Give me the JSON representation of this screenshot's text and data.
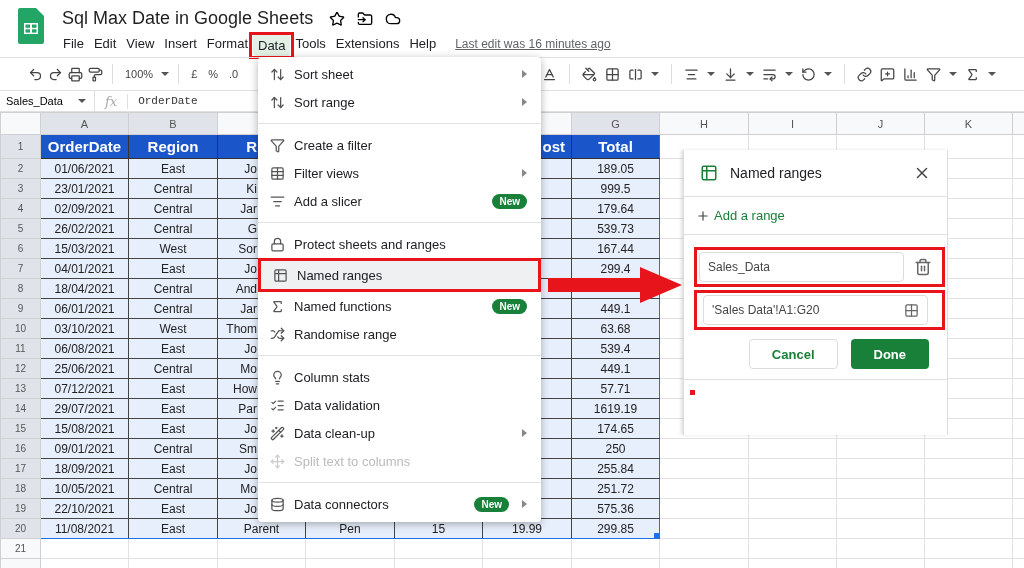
{
  "header": {
    "title": "Sql Max Date in Google Sheets",
    "menus": [
      {
        "label": "File",
        "selected": false,
        "annotated": false
      },
      {
        "label": "Edit",
        "selected": false,
        "annotated": false
      },
      {
        "label": "View",
        "selected": false,
        "annotated": false
      },
      {
        "label": "Insert",
        "selected": false,
        "annotated": false
      },
      {
        "label": "Format",
        "selected": false,
        "annotated": false
      },
      {
        "label": "Data",
        "selected": true,
        "annotated": true
      },
      {
        "label": "Tools",
        "selected": false,
        "annotated": false
      },
      {
        "label": "Extensions",
        "selected": false,
        "annotated": false
      },
      {
        "label": "Help",
        "selected": false,
        "annotated": false
      }
    ],
    "last_edit": "Last edit was 16 minutes ago"
  },
  "toolbar": {
    "zoom": "100%",
    "currency": "£",
    "percent": "%",
    "decimal": ".0"
  },
  "formula_bar": {
    "name_box": "Sales_Data",
    "fx": "fx",
    "value": "OrderDate"
  },
  "sheet": {
    "columns": [
      {
        "label": "A",
        "selected": true
      },
      {
        "label": "B",
        "selected": true
      },
      null,
      null,
      null,
      null,
      {
        "label": "G",
        "selected": true
      },
      {
        "label": "H",
        "selected": false
      },
      {
        "label": "I",
        "selected": false
      },
      {
        "label": "J",
        "selected": false
      },
      {
        "label": "K",
        "selected": false
      }
    ],
    "rows": [
      {
        "number": "1",
        "selected": true,
        "kind": "header",
        "cells": [
          "OrderDate",
          "Region",
          "R",
          null,
          null,
          "ost",
          "Total"
        ]
      },
      {
        "number": "2",
        "selected": true,
        "kind": "data",
        "cells": [
          "01/06/2021",
          "East",
          "Jo",
          null,
          null,
          null,
          "189.05"
        ]
      },
      {
        "number": "3",
        "selected": true,
        "kind": "data",
        "cells": [
          "23/01/2021",
          "Central",
          "Ki",
          null,
          null,
          null,
          "999.5"
        ]
      },
      {
        "number": "4",
        "selected": true,
        "kind": "data",
        "cells": [
          "02/09/2021",
          "Central",
          "Jar",
          null,
          null,
          null,
          "179.64"
        ]
      },
      {
        "number": "5",
        "selected": true,
        "kind": "data",
        "cells": [
          "26/02/2021",
          "Central",
          "G",
          null,
          null,
          null,
          "539.73"
        ]
      },
      {
        "number": "6",
        "selected": true,
        "kind": "data",
        "cells": [
          "15/03/2021",
          "West",
          "Sor",
          null,
          null,
          null,
          "167.44"
        ]
      },
      {
        "number": "7",
        "selected": true,
        "kind": "data",
        "cells": [
          "04/01/2021",
          "East",
          "Jo",
          null,
          null,
          null,
          "299.4"
        ]
      },
      {
        "number": "8",
        "selected": true,
        "kind": "data",
        "cells": [
          "18/04/2021",
          "Central",
          "And",
          null,
          null,
          null,
          null
        ]
      },
      {
        "number": "9",
        "selected": true,
        "kind": "data",
        "cells": [
          "06/01/2021",
          "Central",
          "Jar",
          null,
          null,
          null,
          "449.1"
        ]
      },
      {
        "number": "10",
        "selected": true,
        "kind": "data",
        "cells": [
          "03/10/2021",
          "West",
          "Thom",
          null,
          null,
          null,
          "63.68"
        ]
      },
      {
        "number": "11",
        "selected": true,
        "kind": "data",
        "cells": [
          "06/08/2021",
          "East",
          "Jo",
          null,
          null,
          null,
          "539.4"
        ]
      },
      {
        "number": "12",
        "selected": true,
        "kind": "data",
        "cells": [
          "25/06/2021",
          "Central",
          "Mo",
          null,
          null,
          null,
          "449.1"
        ]
      },
      {
        "number": "13",
        "selected": true,
        "kind": "data",
        "cells": [
          "07/12/2021",
          "East",
          "How",
          null,
          null,
          null,
          "57.71"
        ]
      },
      {
        "number": "14",
        "selected": true,
        "kind": "data",
        "cells": [
          "29/07/2021",
          "East",
          "Par",
          null,
          null,
          null,
          "1619.19"
        ]
      },
      {
        "number": "15",
        "selected": true,
        "kind": "data",
        "cells": [
          "15/08/2021",
          "East",
          "Jo",
          null,
          null,
          null,
          "174.65"
        ]
      },
      {
        "number": "16",
        "selected": true,
        "kind": "data",
        "cells": [
          "09/01/2021",
          "Central",
          "Sm",
          null,
          null,
          null,
          "250"
        ]
      },
      {
        "number": "17",
        "selected": true,
        "kind": "data",
        "cells": [
          "18/09/2021",
          "East",
          "Jo",
          null,
          null,
          null,
          "255.84"
        ]
      },
      {
        "number": "18",
        "selected": true,
        "kind": "data",
        "cells": [
          "10/05/2021",
          "Central",
          "Mo",
          null,
          null,
          null,
          "251.72"
        ]
      },
      {
        "number": "19",
        "selected": true,
        "kind": "data",
        "cells": [
          "22/10/2021",
          "East",
          "Jo",
          null,
          null,
          null,
          "575.36"
        ]
      },
      {
        "number": "20",
        "selected": true,
        "kind": "data",
        "cells": [
          "11/08/2021",
          "East",
          "Parent",
          "Pen",
          "15",
          "19.99",
          "299.85"
        ]
      },
      {
        "number": "21",
        "selected": false,
        "kind": "empty"
      }
    ]
  },
  "data_menu": {
    "items": [
      {
        "kind": "item",
        "label": "Sort sheet",
        "submenu": true,
        "selected": false,
        "annotated": false,
        "disabled": false
      },
      {
        "kind": "item",
        "label": "Sort range",
        "submenu": true,
        "selected": false,
        "annotated": false,
        "disabled": false
      },
      {
        "kind": "divider"
      },
      {
        "kind": "item",
        "label": "Create a filter",
        "submenu": false,
        "selected": false,
        "annotated": false,
        "disabled": false
      },
      {
        "kind": "item",
        "label": "Filter views",
        "submenu": true,
        "selected": false,
        "annotated": false,
        "disabled": false
      },
      {
        "kind": "item",
        "label": "Add a slicer",
        "badge": "New",
        "submenu": false,
        "selected": false,
        "annotated": false,
        "disabled": false
      },
      {
        "kind": "divider"
      },
      {
        "kind": "item",
        "label": "Protect sheets and ranges",
        "submenu": false,
        "selected": false,
        "annotated": false,
        "disabled": false
      },
      {
        "kind": "item",
        "label": "Named ranges",
        "submenu": false,
        "selected": true,
        "annotated": true,
        "disabled": false
      },
      {
        "kind": "item",
        "label": "Named functions",
        "badge": "New",
        "submenu": false,
        "selected": false,
        "annotated": false,
        "disabled": false
      },
      {
        "kind": "item",
        "label": "Randomise range",
        "submenu": false,
        "selected": false,
        "annotated": false,
        "disabled": false
      },
      {
        "kind": "divider"
      },
      {
        "kind": "item",
        "label": "Column stats",
        "submenu": false,
        "selected": false,
        "annotated": false,
        "disabled": false
      },
      {
        "kind": "item",
        "label": "Data validation",
        "submenu": false,
        "selected": false,
        "annotated": false,
        "disabled": false
      },
      {
        "kind": "item",
        "label": "Data clean-up",
        "submenu": true,
        "selected": false,
        "annotated": false,
        "disabled": false
      },
      {
        "kind": "item",
        "label": "Split text to columns",
        "submenu": false,
        "selected": false,
        "annotated": false,
        "disabled": true
      },
      {
        "kind": "divider"
      },
      {
        "kind": "item",
        "label": "Data connectors",
        "badge": "New",
        "submenu": true,
        "selected": false,
        "annotated": false,
        "disabled": false
      }
    ]
  },
  "named_ranges_panel": {
    "title": "Named ranges",
    "add_link": "Add a range",
    "name_field": {
      "value": "Sales_Data",
      "annotated": true
    },
    "range_field": {
      "value": "'Sales Data'!A1:G20",
      "annotated": true
    },
    "buttons": [
      {
        "kind": "secondary",
        "label": "Cancel"
      },
      {
        "kind": "primary",
        "label": "Done"
      }
    ]
  }
}
